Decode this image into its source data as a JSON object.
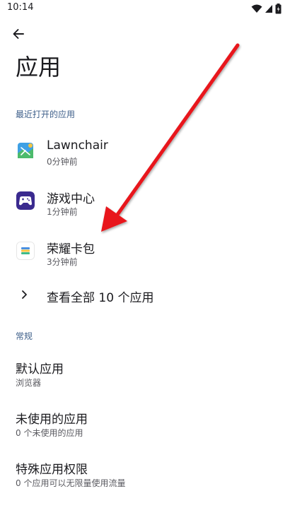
{
  "status_bar": {
    "time": "10:14",
    "icons": [
      "wifi-icon",
      "signal-icon",
      "battery-icon"
    ]
  },
  "header": {
    "back_icon": "arrow-back-icon",
    "title": "应用"
  },
  "recent_section": {
    "header": "最近打开的应用",
    "apps": [
      {
        "name": "Lawnchair",
        "time": "0分钟前",
        "icon": "lawnchair-icon"
      },
      {
        "name": "游戏中心",
        "time": "1分钟前",
        "icon": "game-center-icon"
      },
      {
        "name": "荣耀卡包",
        "time": "3分钟前",
        "icon": "honor-wallet-icon"
      }
    ],
    "see_all": "查看全部 10 个应用"
  },
  "general_section": {
    "header": "常规",
    "items": [
      {
        "title": "默认应用",
        "subtitle": "浏览器"
      },
      {
        "title": "未使用的应用",
        "subtitle": "0 个未使用的应用"
      },
      {
        "title": "特殊应用权限",
        "subtitle": "0 个应用可以无限量使用流量"
      }
    ]
  },
  "colors": {
    "section_header": "#3e5f8a",
    "annotation_arrow": "#e8141a"
  }
}
